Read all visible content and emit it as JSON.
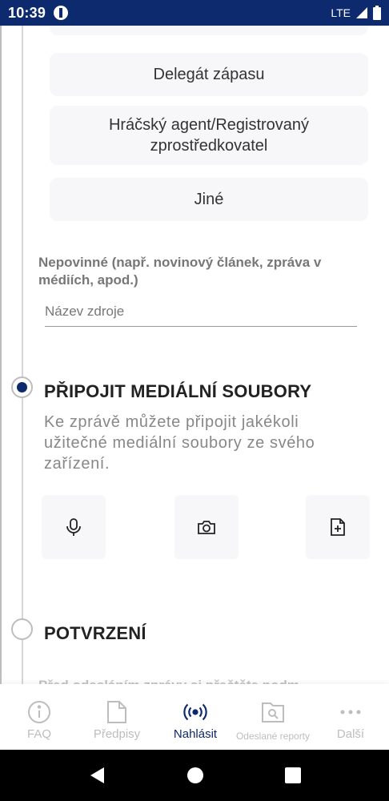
{
  "status_bar": {
    "time": "10:39",
    "network": "LTE"
  },
  "report_types": [
    {
      "label": "Delegát zápasu"
    },
    {
      "label": "Hráčský agent/Registrovaný zprostředkovatel"
    },
    {
      "label": "Jiné"
    }
  ],
  "source": {
    "optional_label": "Nepovinné (např. novinový článek, zpráva v médiích, apod.)",
    "placeholder": "Název zdroje",
    "value": ""
  },
  "media_section": {
    "title": "PŘIPOJIT MEDIÁLNÍ SOUBORY",
    "description": "Ke zprávě můžete připojit jakékoli užitečné mediální soubory ze svého zařízení.",
    "buttons": [
      {
        "icon": "microphone-icon"
      },
      {
        "icon": "camera-icon"
      },
      {
        "icon": "add-file-icon"
      }
    ]
  },
  "confirm_section": {
    "title": "POTVRZENÍ",
    "partial_text": "Před odesláním zprávy si přečtěte podm"
  },
  "bottom_nav": {
    "items": [
      {
        "label": "FAQ",
        "icon": "info-icon"
      },
      {
        "label": "Předpisy",
        "icon": "document-icon"
      },
      {
        "label": "Nahlásit",
        "icon": "broadcast-icon",
        "active": true
      },
      {
        "label": "Odeslané reporty",
        "icon": "search-document-icon"
      },
      {
        "label": "Další",
        "icon": "more-icon"
      }
    ]
  },
  "colors": {
    "primary": "#0d2a6e",
    "inactive": "#bdbdbd",
    "card": "#f7f6f8"
  }
}
